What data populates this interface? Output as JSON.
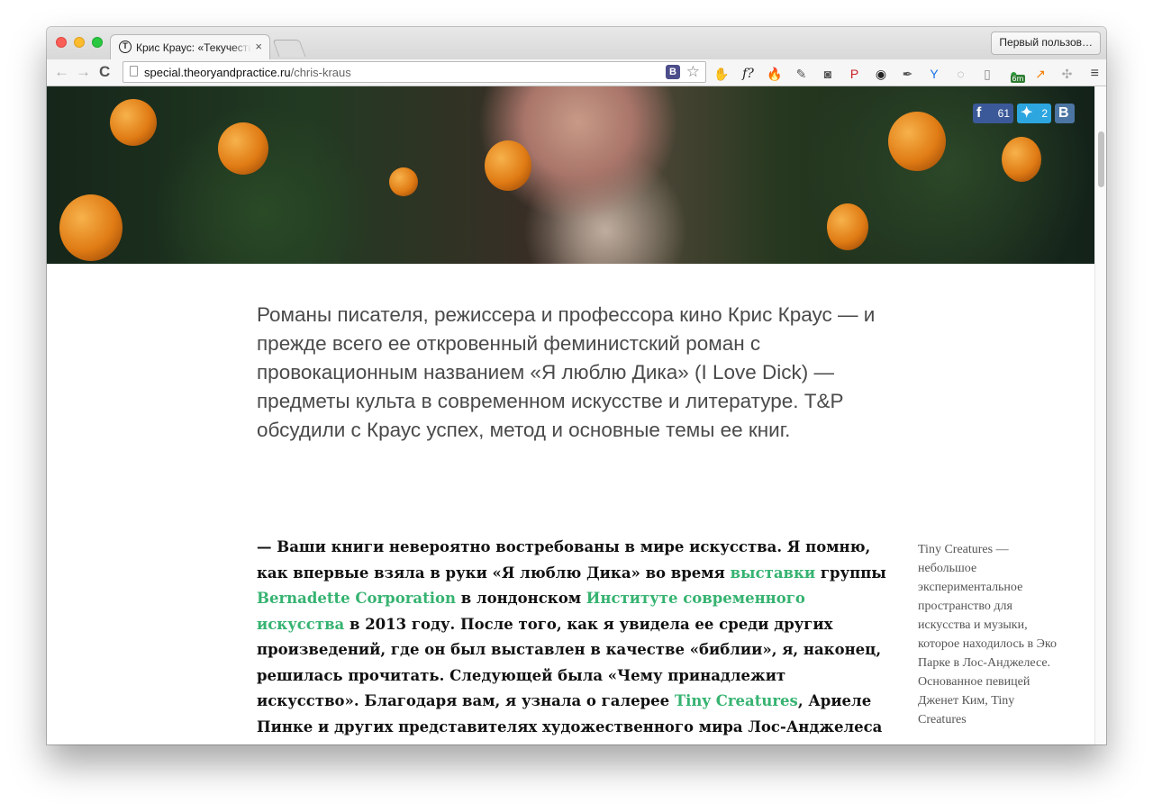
{
  "browser": {
    "tab_title": "Крис Краус: «Текучесть — ",
    "tab_favicon": "T",
    "tab_close": "×",
    "profile_label": "Первый пользов…",
    "url_host": "special.theoryandpractice.ru",
    "url_path": "/chris-kraus",
    "back": "←",
    "forward": "→",
    "reload": "C",
    "vk_extension": "В",
    "bookmark_star": "☆",
    "menu": "≡",
    "extensions": [
      {
        "name": "adblock-icon",
        "glyph": "✋",
        "color": "#e53935"
      },
      {
        "name": "fontface-icon",
        "glyph": "f?",
        "color": "#222222"
      },
      {
        "name": "fire-icon",
        "glyph": "🔥",
        "color": "#ef6c00"
      },
      {
        "name": "evernote-icon",
        "glyph": "✎",
        "color": "#555555"
      },
      {
        "name": "pocket-icon",
        "glyph": "◙",
        "color": "#555555"
      },
      {
        "name": "pinterest-icon",
        "glyph": "P",
        "color": "#cb2027"
      },
      {
        "name": "lens-icon",
        "glyph": "◉",
        "color": "#222222"
      },
      {
        "name": "eyedropper-icon",
        "glyph": "✒",
        "color": "#555555"
      },
      {
        "name": "yandex-icon",
        "glyph": "Y",
        "color": "#1a73e8"
      },
      {
        "name": "spinner-icon",
        "glyph": "◌",
        "color": "#888888"
      },
      {
        "name": "reader-icon",
        "glyph": "▯",
        "color": "#888888"
      },
      {
        "name": "badge-ext-icon",
        "glyph": "●",
        "color": "#2e9b3a"
      },
      {
        "name": "stats-icon",
        "glyph": "↗",
        "color": "#f57c00"
      },
      {
        "name": "paw-icon",
        "glyph": "✣",
        "color": "#aaaaaa"
      }
    ],
    "badge_text": "6m"
  },
  "share": {
    "fb_count": "61",
    "tw_count": "2",
    "fb_icon": "f",
    "tw_icon": "✦",
    "vk_icon": "В"
  },
  "lead_text": "Романы писателя, режиссера и профессора кино Крис Краус — и прежде всего ее откровенный феминистский роман с провокационным названием «Я люблю Дика» (I Love Dick) — предметы культа в современном искусстве и литературе. T&P обсудили с Краус успех, метод и основные темы ее книг.",
  "article": {
    "p1": "— Ваши книги невероятно востребованы в мире искусства. Я помню, как впервые взяла в руки «Я люблю Дика» во время ",
    "link1": "выставки",
    "p2": " группы ",
    "link2": "Bernadette Corporation",
    "p3": " в лондонском ",
    "link3": "Институте современного искусства",
    "p4": " в 2013 году. После того, как я увидела ее среди других произведений, где он был выставлен в качестве «библии», я, наконец, решилась прочитать. Следующей была «Чему принадлежит искусство». Благодаря вам, я узнала о галерее ",
    "link4": "Tiny Creatures",
    "p5": ", Ариеле Пинке и других представителях художественного мира Лос-Анджелеса того времени. Что, на ваш взгляд,"
  },
  "sidenote": "Tiny Creatures — небольшое экспериментальное пространство для искусства и музыки, которое находилось в Эко Парке в Лос-Анджелесе. Основанное певицей Дженет Ким, Tiny Creatures",
  "colors": {
    "link": "#36b371",
    "lead": "#4a4a4a"
  }
}
